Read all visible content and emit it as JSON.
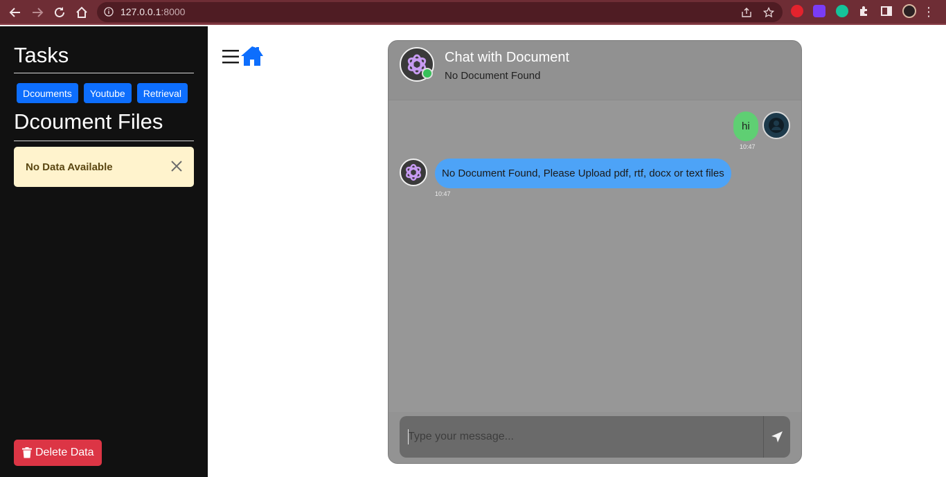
{
  "browser": {
    "url_host": "127.0.0.1",
    "url_port": ":8000"
  },
  "sidebar": {
    "tasks_heading": "Tasks",
    "task_buttons": [
      "Dcouments",
      "Youtube",
      "Retrieval"
    ],
    "files_heading": "Dcoument Files",
    "alert_text": "No Data Available",
    "delete_label": "Delete Data"
  },
  "chat": {
    "title": "Chat with Document",
    "subtitle": "No Document Found",
    "messages": [
      {
        "from": "user",
        "text": "hi",
        "time": "10:47"
      },
      {
        "from": "bot",
        "text": "No Document Found, Please Upload pdf, rtf, docx or text files",
        "time": "10:47"
      }
    ],
    "input_placeholder": "Type your message..."
  },
  "colors": {
    "chrome": "#6e2d35",
    "sidebar_bg": "#111111",
    "primary": "#0d6efd",
    "danger": "#dc3545",
    "alert_bg": "#fff3cd",
    "card_bg": "#979797",
    "user_bubble": "#5fcf73",
    "bot_bubble": "#4da3f7",
    "online": "#38c05a"
  }
}
